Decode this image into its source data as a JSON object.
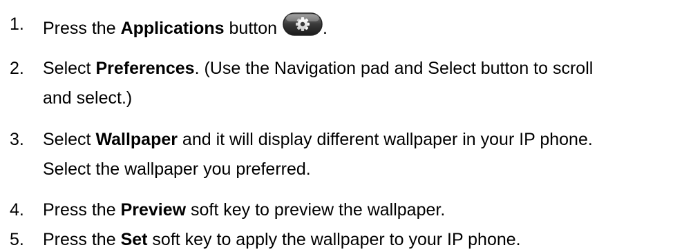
{
  "steps": [
    {
      "number": "1.",
      "pre": "Press the ",
      "bold": "Applications",
      "post": " button",
      "icon": "applications-gear-icon",
      "after_icon": "."
    },
    {
      "number": "2.",
      "pre": "Select ",
      "bold": "Preferences",
      "post": ". (Use the Navigation pad and Select button to scroll",
      "continuation": "and select.)"
    },
    {
      "number": "3.",
      "pre": "Select ",
      "bold": "Wallpaper",
      "post": " and it will display different wallpaper in your IP phone.",
      "continuation": "Select the wallpaper you preferred."
    },
    {
      "number": "4.",
      "pre": "Press the ",
      "bold": "Preview",
      "post": " soft key to preview the wallpaper."
    },
    {
      "number": "5.",
      "pre": "Press the ",
      "bold": "Set",
      "post": " soft key to apply the wallpaper to your IP phone."
    }
  ]
}
